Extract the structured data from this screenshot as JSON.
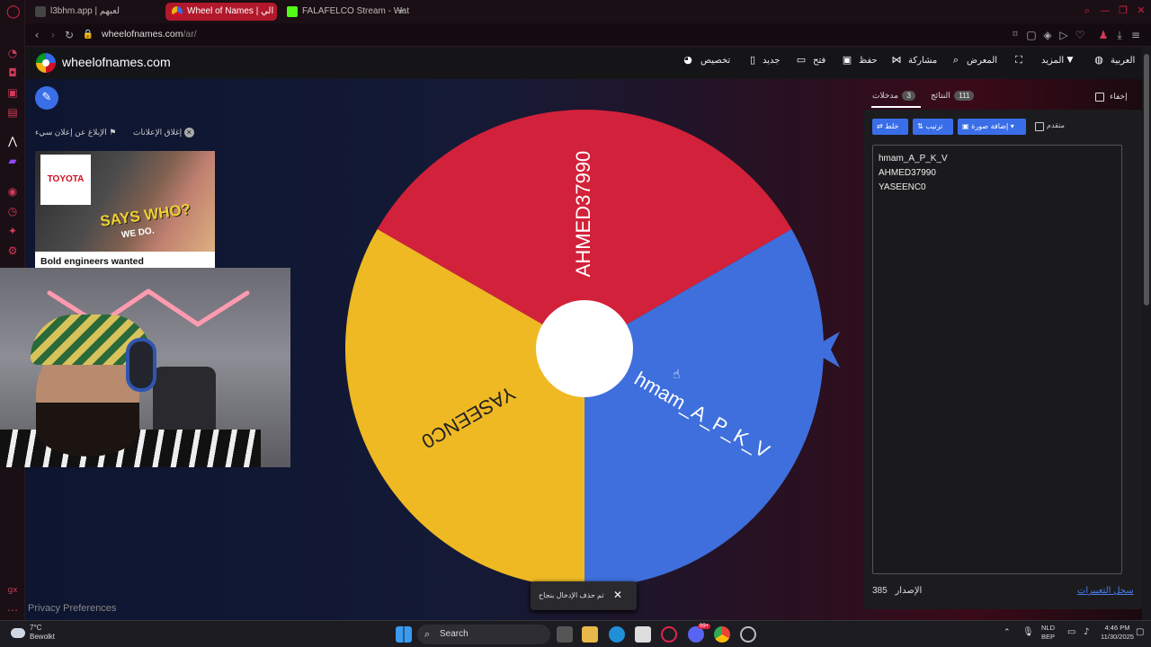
{
  "browser": {
    "tabs": [
      {
        "title": "l3bhm.app | لعبهم"
      },
      {
        "title": "Wheel of Names | الي"
      },
      {
        "title": "FALAFELCO Stream - Wat"
      }
    ],
    "new_tab": "+",
    "url_host": "wheelofnames.com",
    "url_path": "/ar/"
  },
  "site": {
    "name": "wheelofnames.com",
    "menu": {
      "customize": "تخصيص",
      "new": "جديد",
      "open": "فتح",
      "save": "حفظ",
      "share": "مشاركة",
      "gallery": "المعرض",
      "more": "المزيد",
      "language": "العربية"
    }
  },
  "ads": {
    "close_ads": "إغلاق الإعلانات",
    "report_ad": "الإبلاغ عن إعلان سيء",
    "brand": "TOYOTA",
    "slogan": "SAYS WHO?",
    "slogan2": "WE DO.",
    "title": "Bold engineers wanted"
  },
  "wheel": {
    "segments": [
      {
        "label": "AHMED37990",
        "color": "#d2213a"
      },
      {
        "label": "hmam_A_P_K_V",
        "color": "#3e6fdc"
      },
      {
        "label": "YASEENC0",
        "color": "#efb923"
      }
    ],
    "pointer_color": "#3e6fdc"
  },
  "toast": {
    "text": "تم حذف الإدخال بنجاح",
    "close": "✕"
  },
  "panel": {
    "hide_label": "إخفاء",
    "tab_results": "النتائج",
    "tab_results_count": "111",
    "tab_entries": "مدخلات",
    "tab_entries_count": "3",
    "btn_shuffle": "خلط",
    "btn_sort": "ترتيب",
    "btn_add_image": "إضافة صورة",
    "advanced_label": "متقدم",
    "entries": [
      "hmam_A_P_K_V",
      "AHMED37990",
      "YASEENC0"
    ],
    "version_label": "الإصدار",
    "version_number": "385",
    "changelog": "سجل التغييرات"
  },
  "privacy": "Privacy Preferences",
  "taskbar": {
    "temp": "7°C",
    "weather_text": "Bewolkt",
    "search": "Search",
    "lang1": "NLD",
    "lang2": "BEP",
    "time": "4:46 PM",
    "date": "11/30/2025",
    "discord_badge": "99+"
  },
  "colors": {
    "accent": "#3a6ee8",
    "opera_red": "#b2182b"
  }
}
